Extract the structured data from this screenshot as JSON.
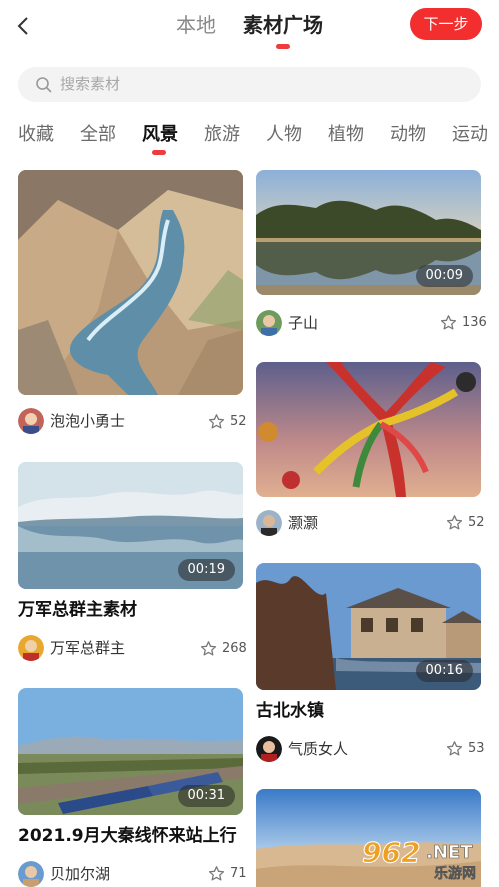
{
  "header": {
    "back_icon": "chevron-left-icon",
    "tabs": [
      {
        "label": "本地",
        "active": false
      },
      {
        "label": "素材广场",
        "active": true
      }
    ],
    "next_label": "下一步",
    "accent_color": "#f22e2e"
  },
  "search": {
    "placeholder": "搜索素材",
    "icon": "search-icon"
  },
  "categories": [
    "收藏",
    "全部",
    "风景",
    "旅游",
    "人物",
    "植物",
    "动物",
    "运动"
  ],
  "active_category": "风景",
  "cards": {
    "canyon": {
      "author": "泡泡小勇士",
      "likes": "52"
    },
    "lake_reflection": {
      "duration": "00:09",
      "author": "子山",
      "likes": "136"
    },
    "frozen_lake": {
      "duration": "00:19",
      "title": "万军总群主素材",
      "author": "万军总群主",
      "likes": "268"
    },
    "ribbons": {
      "author": "灏灏",
      "likes": "52"
    },
    "old_town": {
      "duration": "00:16",
      "title": "古北水镇",
      "author": "气质女人",
      "likes": "53"
    },
    "train": {
      "duration": "00:31",
      "title": "2021.9月大秦线怀来站上行",
      "author": "贝加尔湖",
      "likes": "71"
    },
    "desert": {}
  },
  "watermark": {
    "main": "962.NET",
    "sub": "乐游网"
  }
}
